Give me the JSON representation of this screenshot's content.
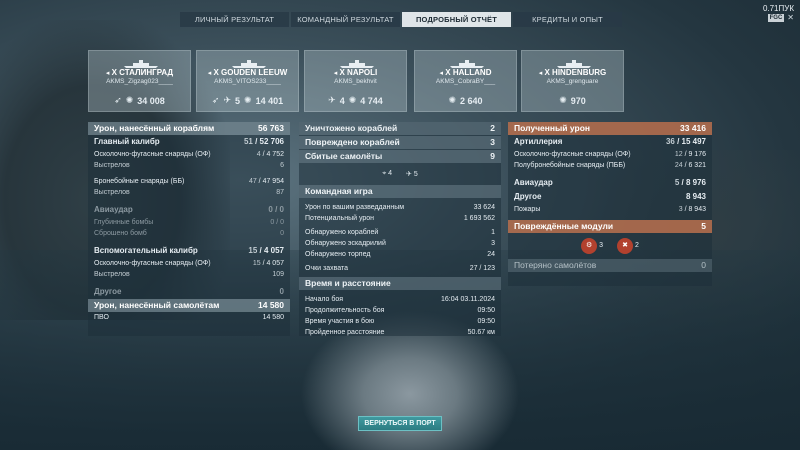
{
  "tabs": [
    {
      "label": "ЛИЧНЫЙ РЕЗУЛЬТАТ"
    },
    {
      "label": "КОМАНДНЫЙ РЕЗУЛЬТАТ"
    },
    {
      "label": "ПОДРОБНЫЙ ОТЧЁТ"
    },
    {
      "label": "КРЕДИТЫ И ОПЫТ"
    }
  ],
  "topright": {
    "ping": "0.71ПУК",
    "badge": "FGC"
  },
  "ships": [
    {
      "name": "X СТАЛИНГРАД",
      "player": "AKMS_Zigzag023____",
      "icon1": "torpedo-icon",
      "value": "34 008"
    },
    {
      "name": "X GOUDEN LEEUW",
      "player": "AKMS_VITOS233____",
      "count": "5",
      "value": "14 401"
    },
    {
      "name": "X NAPOLI",
      "player": "AKMS_bekhvit",
      "count": "4",
      "value": "4 744"
    },
    {
      "name": "X HALLAND",
      "player": "AKMS_CobraBY___",
      "value": "2 640"
    },
    {
      "name": "X HINDENBURG",
      "player": "AKMS_grenguare",
      "value": "970"
    }
  ],
  "left": {
    "damage_header": {
      "label": "Урон, нанесённый кораблям",
      "value": "56 763"
    },
    "main_battery": {
      "label": "Главный калибр",
      "value_a": "51",
      "value_b": "52 706"
    },
    "he_main": {
      "label": "Осколочно-фугасные снаряды (ОФ)",
      "value_a": "4",
      "value_b": "4 752"
    },
    "shots_he_main": {
      "label": "Выстрелов",
      "value": "6"
    },
    "ap_main": {
      "label": "Бронебойные снаряды (ББ)",
      "value_a": "47",
      "value_b": "47 954"
    },
    "shots_ap_main": {
      "label": "Выстрелов",
      "value": "87"
    },
    "airstrike": {
      "label": "Авиаудар",
      "value": "0 / 0"
    },
    "depth": {
      "label": "Глубинные бомбы",
      "value": "0 / 0"
    },
    "dropped": {
      "label": "Сброшено бомб",
      "value": "0"
    },
    "secondary": {
      "label": "Вспомогательный калибр",
      "value_a": "15",
      "value_b": "4 057"
    },
    "he_sec": {
      "label": "Осколочно-фугасные снаряды (ОФ)",
      "value_a": "15",
      "value_b": "4 057"
    },
    "shots_sec": {
      "label": "Выстрелов",
      "value": "109"
    },
    "other": {
      "label": "Другое",
      "value": "0"
    },
    "planes_header": {
      "label": "Урон, нанесённый самолётам",
      "value": "14 580"
    },
    "aa": {
      "label": "ПВО",
      "value": "14 580"
    }
  },
  "middle": {
    "destroyed": {
      "label": "Уничтожено кораблей",
      "value": "2"
    },
    "damaged": {
      "label": "Повреждено кораблей",
      "value": "3"
    },
    "planes": {
      "label": "Сбитые самолёты",
      "value": "9"
    },
    "icon_a": "4",
    "icon_b": "5",
    "team_header": "Командная игра",
    "spotting_damage": {
      "label": "Урон по вашим разведданным",
      "value": "33 624"
    },
    "potential": {
      "label": "Потенциальный урон",
      "value": "1 693 562"
    },
    "spotted_ships": {
      "label": "Обнаружено кораблей",
      "value": "1"
    },
    "spotted_squadrons": {
      "label": "Обнаружено эскадрилий",
      "value": "3"
    },
    "spotted_torps": {
      "label": "Обнаружено торпед",
      "value": "24"
    },
    "capture": {
      "label": "Очки захвата",
      "value": "27 / 123"
    },
    "time_header": "Время и расстояние",
    "start": {
      "label": "Начало боя",
      "value": "16:04  03.11.2024"
    },
    "duration": {
      "label": "Продолжительность боя",
      "value": "09:50"
    },
    "participation": {
      "label": "Время участия в бою",
      "value": "09:50"
    },
    "distance": {
      "label": "Пройденное расстояние",
      "value": "50.67 км"
    }
  },
  "right": {
    "received_header": {
      "label": "Полученный урон",
      "value": "33 416"
    },
    "artillery": {
      "label": "Артиллерия",
      "value_a": "36",
      "value_b": "15 497"
    },
    "he": {
      "label": "Осколочно-фугасные снаряды (ОФ)",
      "value_a": "12",
      "value_b": "9 176"
    },
    "sap": {
      "label": "Полубронебойные снаряды (ПББ)",
      "value_a": "24",
      "value_b": "6 321"
    },
    "air": {
      "label": "Авиаудар",
      "value_a": "5",
      "value_b": "8 976"
    },
    "other": {
      "label": "Другое",
      "value": "8 943"
    },
    "fires": {
      "label": "Пожары",
      "value_a": "3",
      "value_b": "8 943"
    },
    "modules_header": {
      "label": "Повреждённые модули",
      "value": "5"
    },
    "mod_a": "3",
    "mod_b": "2",
    "lost_planes": {
      "label": "Потеряно самолётов",
      "value": "0"
    }
  },
  "port_button": "ВЕРНУТЬСЯ В ПОРТ"
}
